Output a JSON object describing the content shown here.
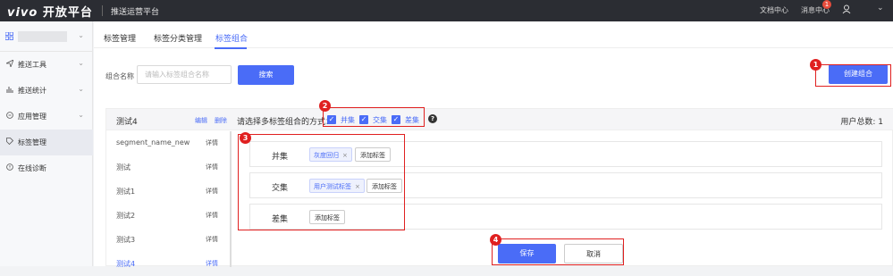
{
  "header": {
    "brand": "vivo",
    "platform": "开放平台",
    "subtitle": "推送运营平台",
    "docs": "文档中心",
    "messages": "消息中心",
    "message_count": "1"
  },
  "sidebar": {
    "items": [
      {
        "label": "推送工具",
        "icon": "send-icon"
      },
      {
        "label": "推送统计",
        "icon": "bar-chart-icon"
      },
      {
        "label": "应用管理",
        "icon": "app-icon"
      },
      {
        "label": "标签管理",
        "icon": "tag-icon"
      },
      {
        "label": "在线诊断",
        "icon": "diagnose-icon"
      }
    ],
    "active": "标签管理"
  },
  "tabs": [
    "标签管理",
    "标签分类管理",
    "标签组合"
  ],
  "active_tab": "标签组合",
  "search": {
    "label": "组合名称",
    "placeholder": "请输入标签组合名称",
    "button": "搜索"
  },
  "create_button": "创建组合",
  "panel": {
    "group_name": "测试4",
    "edit": "编辑",
    "delete": "删除",
    "combine_prompt": "请选择多标签组合的方式：",
    "options": [
      "并集",
      "交集",
      "差集"
    ],
    "user_total": "用户总数: 1"
  },
  "list": {
    "detail_label": "详情",
    "items": [
      "segment_name_new",
      "测试",
      "测试1",
      "测试2",
      "测试3",
      "测试4"
    ],
    "active": "测试4"
  },
  "operations": [
    {
      "name": "并集",
      "tags": [
        "灰度回归"
      ],
      "add_label": "添加标签"
    },
    {
      "name": "交集",
      "tags": [
        "用户测试标签"
      ],
      "add_label": "添加标签"
    },
    {
      "name": "差集",
      "tags": [],
      "add_label": "添加标签"
    }
  ],
  "footer": {
    "save": "保存",
    "cancel": "取消"
  },
  "annotations": [
    "1",
    "2",
    "3",
    "4"
  ],
  "colors": {
    "accent": "#4a6cf7",
    "annotation": "#e02020",
    "topbar": "#2b2d33"
  }
}
